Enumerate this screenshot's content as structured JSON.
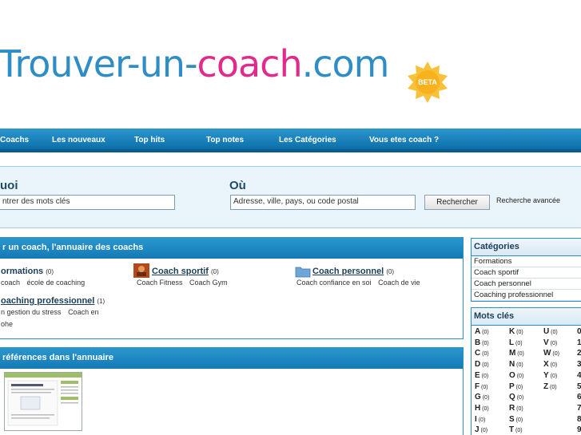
{
  "logo": {
    "part1": "Trouver-un-",
    "part2": "coach",
    "part3": ".com",
    "badge": "BETA"
  },
  "nav": [
    "Coachs",
    "Les nouveaux",
    "Top hits",
    "Top notes",
    "Les Catégories",
    "Vous etes coach ?"
  ],
  "search": {
    "quoi_label": "uoi",
    "ou_label": "Où",
    "quoi_value": "ntrer des mots clés",
    "ou_value": "Adresse, ville, pays, ou code postal",
    "button": "Rechercher",
    "advanced": "Recherche avancée"
  },
  "annuaire": {
    "title": "r un coach, l'annuaire des coachs",
    "categories": [
      {
        "name": "ormations",
        "count": "(0)",
        "subs": [
          "coach",
          "école de coaching"
        ]
      },
      {
        "name": "Coach sportif",
        "count": "(0)",
        "subs": [
          "Coach Fitness",
          "Coach Gym"
        ]
      },
      {
        "name": "Coach personnel",
        "count": "(0)",
        "subs": [
          "Coach confiance en soi",
          "Coach de vie"
        ]
      },
      {
        "name": "oaching professionnel",
        "count": "(1)",
        "subs": [
          "n gestion du stress",
          "Coach en"
        ],
        "extra": "ohe"
      }
    ]
  },
  "references": {
    "title": "références dans l'annuaire"
  },
  "sidebar": {
    "categories_title": "Catégories",
    "categories": [
      "Formations",
      "Coach sportif",
      "Coach personnel",
      "Coaching professionnel"
    ],
    "keywords_title": "Mots clés",
    "keyword_columns": [
      [
        [
          "A",
          "(0)"
        ],
        [
          "B",
          "(0)"
        ],
        [
          "C",
          "(0)"
        ],
        [
          "D",
          "(0)"
        ],
        [
          "E",
          "(0)"
        ],
        [
          "F",
          "(0)"
        ],
        [
          "G",
          "(0)"
        ],
        [
          "H",
          "(0)"
        ],
        [
          "I",
          "(0)"
        ],
        [
          "J",
          "(0)"
        ]
      ],
      [
        [
          "K",
          "(0)"
        ],
        [
          "L",
          "(0)"
        ],
        [
          "M",
          "(0)"
        ],
        [
          "N",
          "(0)"
        ],
        [
          "O",
          "(0)"
        ],
        [
          "P",
          "(0)"
        ],
        [
          "Q",
          "(0)"
        ],
        [
          "R",
          "(0)"
        ],
        [
          "S",
          "(0)"
        ],
        [
          "T",
          "(0)"
        ]
      ],
      [
        [
          "U",
          "(0)"
        ],
        [
          "V",
          "(0)"
        ],
        [
          "W",
          "(0)"
        ],
        [
          "X",
          "(0)"
        ],
        [
          "Y",
          "(0)"
        ],
        [
          "Z",
          "(0)"
        ]
      ],
      [
        [
          "0",
          ""
        ],
        [
          "1",
          ""
        ],
        [
          "2",
          ""
        ],
        [
          "3",
          ""
        ],
        [
          "4",
          ""
        ],
        [
          "5",
          ""
        ],
        [
          "6",
          ""
        ],
        [
          "7",
          ""
        ],
        [
          "8",
          ""
        ],
        [
          "9",
          ""
        ]
      ]
    ]
  },
  "colors": {
    "brand_blue": "#2f8dc6",
    "brand_pink": "#e12b8a",
    "nav_blue": "#1379b4",
    "badge": "#f7c23a"
  }
}
